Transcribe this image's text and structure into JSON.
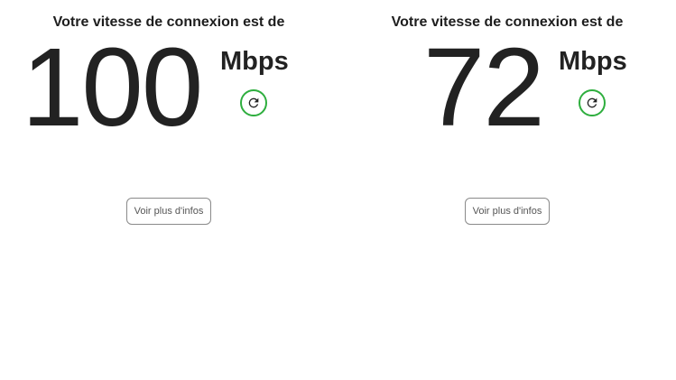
{
  "left_panel": {
    "heading": "Votre vitesse de connexion est de",
    "speed_value": "100",
    "unit": "Mbps",
    "refresh_icon": "refresh-icon",
    "more_info_label": "Voir plus d'infos"
  },
  "right_panel": {
    "heading": "Votre vitesse de connexion est de",
    "speed_value": "72",
    "unit": "Mbps",
    "refresh_icon": "refresh-icon",
    "more_info_label": "Voir plus d'infos"
  },
  "colors": {
    "accent_green": "#2eae3e",
    "text_dark": "#222222",
    "button_border": "#8a8a8a"
  }
}
